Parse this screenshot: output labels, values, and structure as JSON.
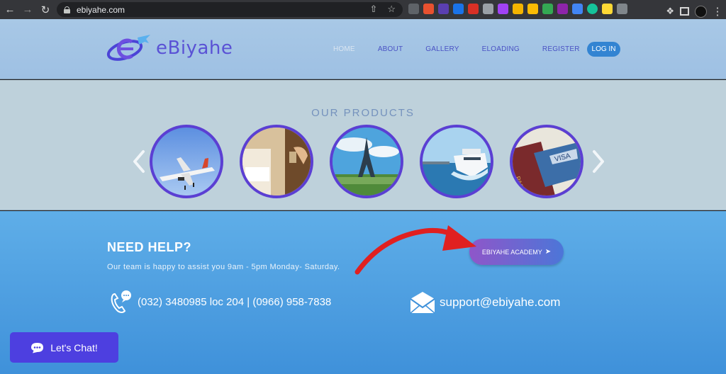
{
  "browser": {
    "url": "ebiyahe.com"
  },
  "site": {
    "logo_text": "eBiyahe",
    "nav": [
      {
        "label": "HOME",
        "active": true
      },
      {
        "label": "ABOUT",
        "active": false
      },
      {
        "label": "GALLERY",
        "active": false
      },
      {
        "label": "ELOADING",
        "active": false
      },
      {
        "label": "REGISTER",
        "active": false
      }
    ],
    "login_label": "LOG IN"
  },
  "products": {
    "title": "OUR PRODUCTS",
    "items": [
      {
        "icon": "airplane-image"
      },
      {
        "icon": "hotel-room-image"
      },
      {
        "icon": "eiffel-tower-image"
      },
      {
        "icon": "ferry-boat-image"
      },
      {
        "icon": "passport-visa-image"
      }
    ]
  },
  "help": {
    "title": "NEED HELP?",
    "subtitle": "Our team is happy to assist you 9am - 5pm Monday- Saturday.",
    "academy_label": "EBIYAHE ACADEMY",
    "phone": "(032) 3480985 loc 204   |  (0966) 958-7838",
    "email": "support@ebiyahe.com"
  },
  "chat": {
    "label": "Let's Chat!"
  },
  "colors": {
    "brand": "#5a52d5",
    "header_bg": "#a8c8e6",
    "products_bg": "#bed1db",
    "help_bg": "#4f9fe1",
    "chat_button": "#4d3fe0",
    "annotation_arrow": "#e02020"
  }
}
